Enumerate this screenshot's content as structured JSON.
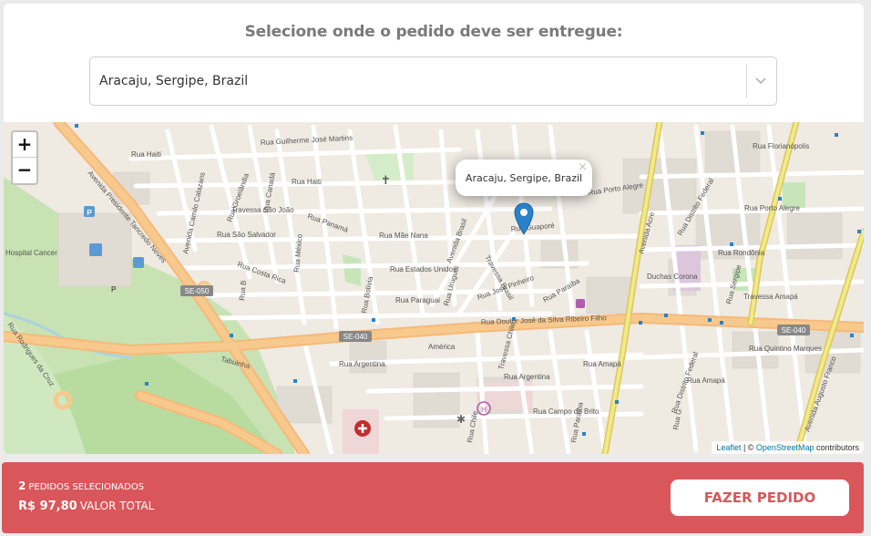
{
  "header": {
    "title": "Selecione onde o pedido deve ser entregue:"
  },
  "address_select": {
    "value": "Aracaju, Sergipe, Brazil"
  },
  "map": {
    "zoom_in_label": "+",
    "zoom_out_label": "−",
    "popup_text": "Aracaju, Sergipe, Brazil",
    "popup_close": "×",
    "attribution": {
      "leaflet": "Leaflet",
      "sep": " | © ",
      "osm": "OpenStreetMap",
      "suffix": " contributors"
    },
    "street_labels": {
      "s1": "Rua Haiti",
      "s2": "Rua Guilherme José Martins",
      "s3": "Rua Haiti",
      "s4": "Avenida Presidente Tancredo Neves",
      "s5": "Rua Groelândia",
      "s6": "Rua Canadá",
      "s7": "Travessa São João",
      "s8": "Rua São Salvador",
      "s9": "Avenida Camilo Calazans",
      "s10": "Rua Costa Rica",
      "s11": "Rua México",
      "s12": "Rua B",
      "s13": "Rua Panamá",
      "s14": "Rua Mãe Nana",
      "s15": "Avenida Brasil",
      "s16": "Rua Estados Unidos",
      "s17": "Rua Bolívia",
      "s18": "Rua Uruguai",
      "s19": "Rua Paraguai",
      "s20": "Rua José Pinheiro",
      "s21": "Rua Guaporé",
      "s22": "Rua Porto Alegre",
      "s23": "Rua Paraíba",
      "s24": "Avenida Acre",
      "s25": "Rua Distrito Federal",
      "s26": "Rua Florianópolis",
      "s27": "Rua Porto Alegre",
      "s28": "Rua Rondônia",
      "s29": "Rua Sergipe",
      "s30": "Travessa Amapá",
      "s31": "Rua Doutor José da Silva Ribeiro Filho",
      "s32": "América",
      "s33": "Rua Argentina",
      "s34": "Rua Argentina",
      "s35": "Rua Amapá",
      "s36": "Rua Quintino Marques",
      "s37": "Rua Campo do Brito",
      "s38": "Rua Amapá",
      "s39": "Rua Paraíba",
      "s40": "Rua Rodrigues da Cruz",
      "s41": "Avenida Augusto Franco",
      "s42": "Duchas Corona",
      "s43": "Travessa Brasil",
      "s44": "Travessa Chile",
      "s45": "Rua Distrito Federal",
      "s46": "Hospital Cancer",
      "s47": "Rua G",
      "s48": "Tabuinha",
      "s49": "Rua Chile"
    },
    "road_shields": {
      "r1": "SE-050",
      "r2": "SE-040",
      "r3": "SE-040"
    }
  },
  "footer": {
    "count": "2",
    "count_label": "PEDIDOS SELECIONADOS",
    "total": "R$ 97,80",
    "total_label": "VALOR TOTAL",
    "order_button": "FAZER PEDIDO"
  },
  "colors": {
    "accent": "#d9575b",
    "heading": "#7a7a7a",
    "marker": "#2a81cb",
    "major_road": "#f7c98c",
    "trunk_road": "#f3e88a"
  }
}
